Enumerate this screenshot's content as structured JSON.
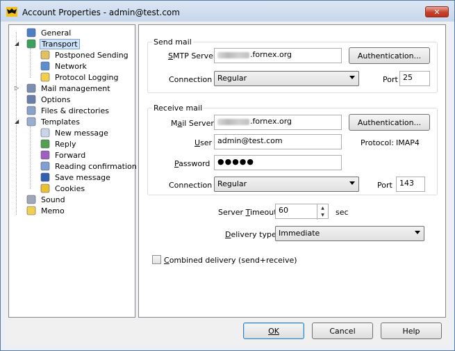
{
  "window": {
    "title": "Account Properties - admin@test.com",
    "close_symbol": "✕"
  },
  "tree": [
    {
      "label": "General",
      "icon": "general-icon"
    },
    {
      "label": "Transport",
      "icon": "transport-icon",
      "selected": true
    },
    {
      "label": "Postponed Sending",
      "icon": "clock-icon"
    },
    {
      "label": "Network",
      "icon": "network-icon"
    },
    {
      "label": "Protocol Logging",
      "icon": "log-icon"
    },
    {
      "label": "Mail management",
      "icon": "mail-management-icon"
    },
    {
      "label": "Options",
      "icon": "options-icon"
    },
    {
      "label": "Files & directories",
      "icon": "files-icon"
    },
    {
      "label": "Templates",
      "icon": "templates-icon"
    },
    {
      "label": "New message",
      "icon": "new-message-icon"
    },
    {
      "label": "Reply",
      "icon": "reply-icon"
    },
    {
      "label": "Forward",
      "icon": "forward-icon"
    },
    {
      "label": "Reading confirmation",
      "icon": "reading-confirmation-icon"
    },
    {
      "label": "Save message",
      "icon": "save-icon"
    },
    {
      "label": "Cookies",
      "icon": "cookies-icon"
    },
    {
      "label": "Sound",
      "icon": "sound-icon"
    },
    {
      "label": "Memo",
      "icon": "memo-icon"
    }
  ],
  "send_mail": {
    "legend": "Send mail",
    "smtp_label_underlined": "S",
    "smtp_label_rest": "MTP Server",
    "smtp_value": ".fornex.org",
    "auth_button": "Authentication...",
    "connection_label": "Connection",
    "connection_value": "Regular",
    "port_label": "Port",
    "port_value": "25"
  },
  "receive_mail": {
    "legend": "Receive mail",
    "server_label_pre": "M",
    "server_label_underlined": "a",
    "server_label_rest": "il Server",
    "server_value": ".fornex.org",
    "auth_button": "Authentication...",
    "user_label_underlined": "U",
    "user_label_rest": "ser",
    "user_value": "admin@test.com",
    "protocol_label": "Protocol:",
    "protocol_value": "IMAP4",
    "password_label_underlined": "P",
    "password_label_rest": "assword",
    "password_value": "●●●●●",
    "connection_label": "Connection",
    "connection_value": "Regular",
    "port_label": "Port",
    "port_value": "143"
  },
  "server_timeout": {
    "label_pre": "Server ",
    "label_underlined": "T",
    "label_rest": "imeout",
    "value": "60",
    "unit": "sec"
  },
  "delivery": {
    "label_underlined": "D",
    "label_rest": "elivery type",
    "value": "Immediate"
  },
  "combined": {
    "label_underlined": "C",
    "label_rest": "ombined delivery (send+receive)",
    "checked": false
  },
  "buttons": {
    "ok": "OK",
    "cancel": "Cancel",
    "help": "Help"
  }
}
